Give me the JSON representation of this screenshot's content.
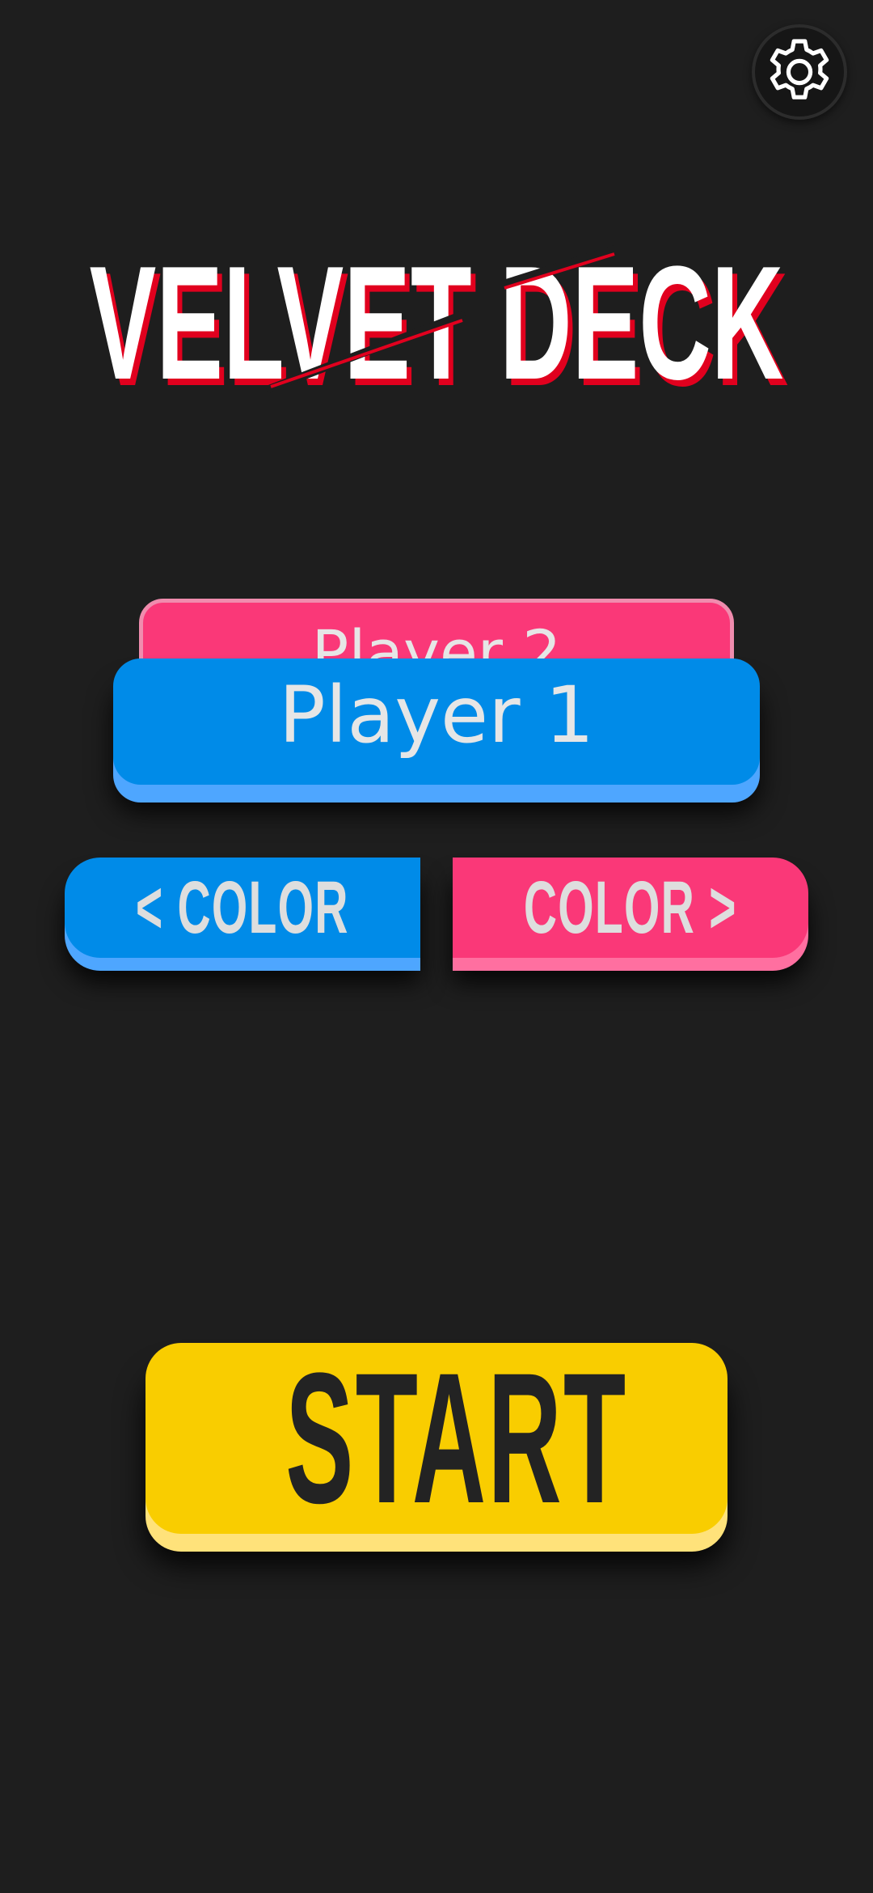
{
  "title": {
    "line": "VELVET DECK"
  },
  "settings": {
    "icon": "gear-icon"
  },
  "players": {
    "player2_label": "Player 2",
    "player1_label": "Player 1"
  },
  "color_buttons": {
    "left_label": "< COLOR",
    "right_label": "COLOR >"
  },
  "start": {
    "label": "START"
  },
  "colors": {
    "background": "#1e1e1e",
    "player1": "#008be8",
    "player2": "#fa3878",
    "start": "#f9cd00",
    "logo_text": "#ffffff",
    "logo_shadow": "#e1001e"
  }
}
